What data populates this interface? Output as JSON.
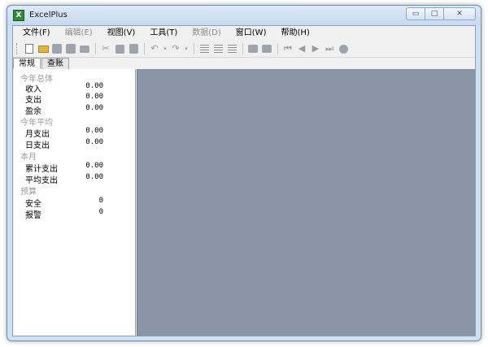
{
  "window": {
    "title": "ExcelPlus",
    "app_icon_glyph": "X"
  },
  "window_controls": {
    "minimize_glyph": "▭",
    "maximize_glyph": "□",
    "close_glyph": "✕"
  },
  "menu": [
    {
      "label": "文件(F)",
      "enabled": true
    },
    {
      "label": "编辑(E)",
      "enabled": false
    },
    {
      "label": "视图(V)",
      "enabled": true
    },
    {
      "label": "工具(T)",
      "enabled": true
    },
    {
      "label": "数据(D)",
      "enabled": false
    },
    {
      "label": "窗口(W)",
      "enabled": true
    },
    {
      "label": "帮助(H)",
      "enabled": true
    }
  ],
  "toolbar_icons": [
    "new-document-icon",
    "open-folder-icon",
    "save-icon",
    "save-all-icon",
    "print-icon",
    "cut-icon",
    "copy-icon",
    "paste-icon",
    "undo-icon",
    "redo-icon",
    "align-left-icon",
    "align-center-icon",
    "align-right-icon",
    "export-icon",
    "import-icon",
    "first-record-icon",
    "previous-record-icon",
    "next-record-icon",
    "last-record-icon",
    "info-icon"
  ],
  "tabs": [
    {
      "label": "常规",
      "active": true
    },
    {
      "label": "查账",
      "active": false
    }
  ],
  "summary": {
    "year_total": {
      "title": "今年总体",
      "income": {
        "label": "收入",
        "value": "0.00"
      },
      "expense": {
        "label": "支出",
        "value": "0.00"
      },
      "surplus": {
        "label": "盈余",
        "value": "0.00"
      }
    },
    "year_average": {
      "title": "今年平均",
      "monthly_expense": {
        "label": "月支出",
        "value": "0.00"
      },
      "daily_expense": {
        "label": "日支出",
        "value": "0.00"
      }
    },
    "this_month": {
      "title": "本月",
      "cumulative_expense": {
        "label": "累计支出",
        "value": "0.00"
      },
      "average_expense": {
        "label": "平均支出",
        "value": "0.00"
      }
    },
    "budget": {
      "title": "预算",
      "safe": {
        "label": "安全",
        "value": "0"
      },
      "alarm": {
        "label": "报警",
        "value": "0"
      }
    }
  },
  "colors": {
    "workspace": "#8a96a8",
    "frame": "#cfe0f1",
    "app_icon": "#2f8a3b"
  }
}
